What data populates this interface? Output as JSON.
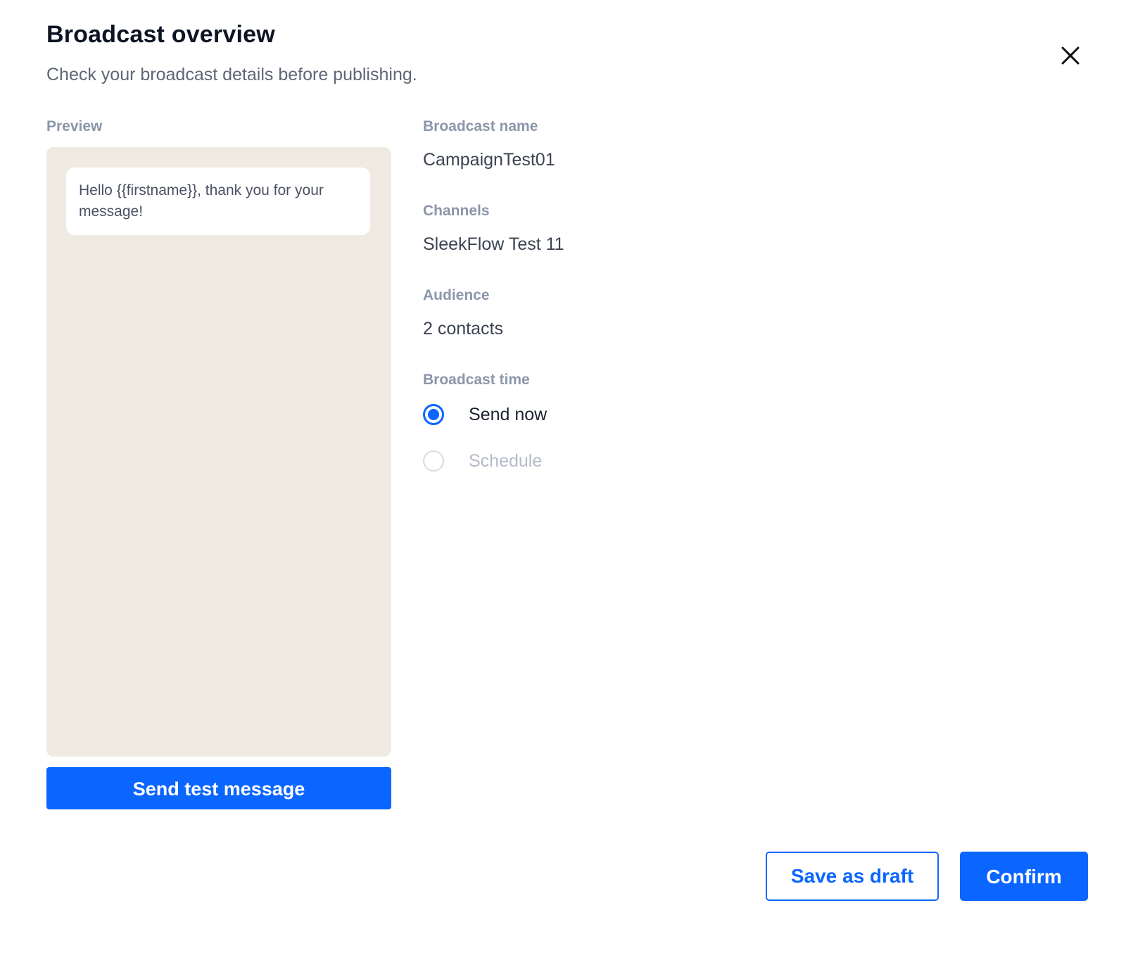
{
  "modal": {
    "title": "Broadcast overview",
    "subtitle": "Check your broadcast details before publishing.",
    "close_icon": "close-icon"
  },
  "preview": {
    "label": "Preview",
    "message": "Hello {{firstname}}, thank you for your message!",
    "background_color": "#efebe3",
    "send_test_label": "Send test message"
  },
  "details": {
    "broadcast_name": {
      "label": "Broadcast name",
      "value": "CampaignTest01"
    },
    "channels": {
      "label": "Channels",
      "value": "SleekFlow Test 11"
    },
    "audience": {
      "label": "Audience",
      "value": "2 contacts"
    },
    "broadcast_time": {
      "label": "Broadcast time",
      "options": [
        {
          "label": "Send now",
          "selected": true,
          "enabled": true
        },
        {
          "label": "Schedule",
          "selected": false,
          "enabled": false
        }
      ]
    }
  },
  "footer": {
    "save_draft_label": "Save as draft",
    "confirm_label": "Confirm"
  },
  "colors": {
    "accent": "#0b66ff",
    "title_text": "#0d1424",
    "label_text": "#8c96aa"
  }
}
